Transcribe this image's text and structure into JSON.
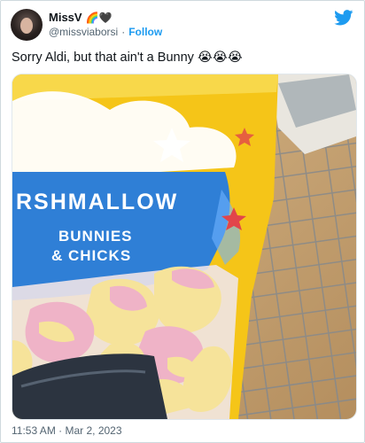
{
  "author": {
    "display_name": "MissV",
    "display_emoji": "🌈🖤",
    "handle": "@missviaborsi",
    "separator": "·",
    "follow_label": "Follow"
  },
  "tweet": {
    "text": "Sorry Aldi, but that ain't a Bunny 😭😭😭",
    "timestamp": "11:53 AM · Mar 2, 2023"
  },
  "package": {
    "brand_text": "RSHMALLOW",
    "line1": "BUNNIES",
    "line2": "& CHICKS"
  },
  "colors": {
    "twitter_blue": "#1d9bf0",
    "bag_yellow": "#f5c518",
    "bag_blue": "#2f7fd6",
    "marshmallow_pink": "#efb3c7",
    "marshmallow_yellow": "#f6e39a"
  }
}
